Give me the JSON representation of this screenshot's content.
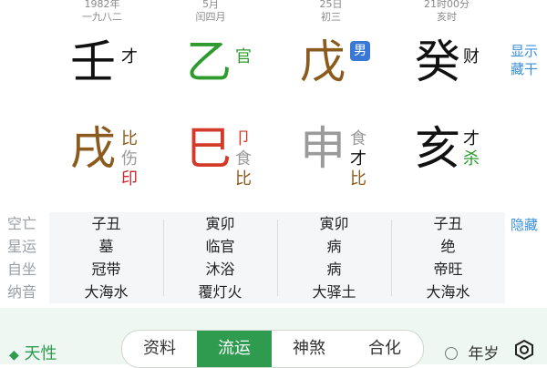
{
  "columns": [
    {
      "head_top": "1982年",
      "head_sub": "一九八二",
      "stem": "壬",
      "stem_color": "#111111",
      "stem_god": "才",
      "branch": "戌",
      "branch_color": "#8b5a1d",
      "branch_gods": [
        "比",
        "伤",
        "印"
      ],
      "branch_god_colors": [
        "#8b5a1d",
        "#9a9a9a",
        "#c8282a"
      ]
    },
    {
      "head_top": "5月",
      "head_sub": "闰四月",
      "stem": "乙",
      "stem_color": "#2e9b2e",
      "stem_god": "官",
      "branch": "巳",
      "branch_color": "#d43a2a",
      "branch_gods": [
        "卩",
        "食",
        "比"
      ],
      "branch_god_colors": [
        "#d43a2a",
        "#9a9a9a",
        "#8b5a1d"
      ]
    },
    {
      "head_top": "25日",
      "head_sub": "初三",
      "stem": "戊",
      "stem_color": "#8b5a1d",
      "stem_badge": "男",
      "branch": "申",
      "branch_color": "#9a9a9a",
      "branch_gods": [
        "食",
        "才",
        "比"
      ],
      "branch_god_colors": [
        "#9a9a9a",
        "#111111",
        "#8b5a1d"
      ]
    },
    {
      "head_top": "21时00分",
      "head_sub": "亥时",
      "stem": "癸",
      "stem_color": "#111111",
      "stem_god": "财",
      "branch": "亥",
      "branch_color": "#111111",
      "branch_gods": [
        "才",
        "杀"
      ],
      "branch_god_colors": [
        "#111111",
        "#2e9b2e"
      ]
    }
  ],
  "side_right": {
    "line1": "显示",
    "line2": "藏干"
  },
  "hide_label": "隐藏",
  "row_labels": [
    "空亡",
    "星运",
    "自坐",
    "纳音"
  ],
  "grid": [
    [
      "子丑",
      "墓",
      "冠带",
      "大海水"
    ],
    [
      "寅卯",
      "临官",
      "沐浴",
      "覆灯火"
    ],
    [
      "寅卯",
      "病",
      "病",
      "大驿土"
    ],
    [
      "子丑",
      "绝",
      "帝旺",
      "大海水"
    ]
  ],
  "bottom": {
    "tianxing_label": "天性",
    "tabs": [
      "资料",
      "流运",
      "神煞",
      "合化"
    ],
    "active_tab": "流运",
    "nian_sui_label": "年岁"
  },
  "colors": {
    "accent_green": "#2e9b4f",
    "link_blue": "#3a8fd9",
    "badge_blue": "#3a78d6"
  }
}
